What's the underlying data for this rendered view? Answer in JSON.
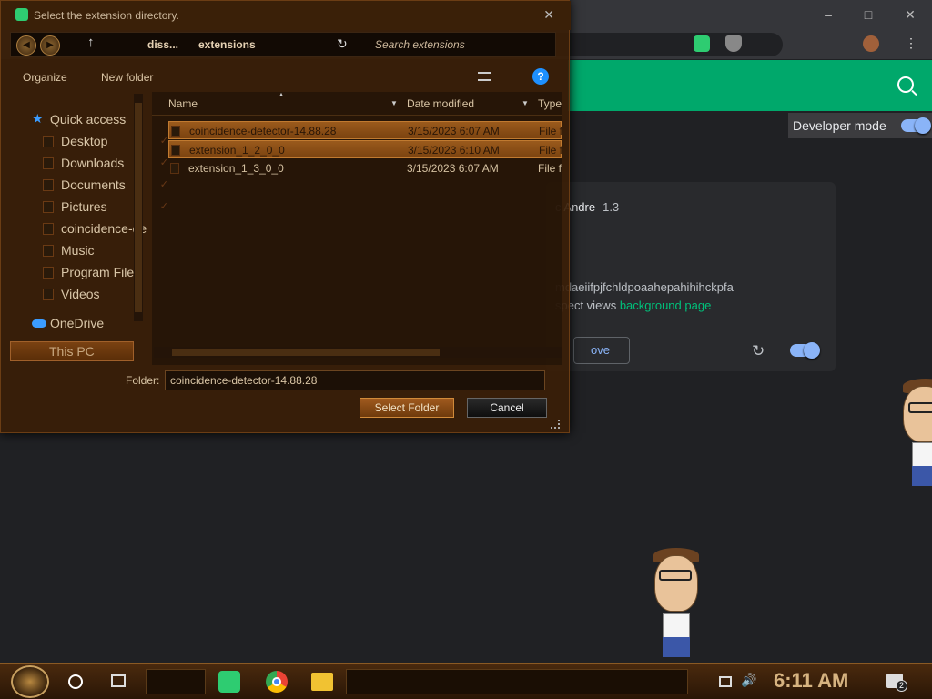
{
  "dialog": {
    "title": "Select the extension directory.",
    "breadcrumb": [
      "diss...",
      "extensions"
    ],
    "search_placeholder": "Search extensions",
    "organize_label": "Organize",
    "new_folder_label": "New folder",
    "tree": [
      {
        "label": "Quick access",
        "icon": "star-icon"
      },
      {
        "label": "Desktop",
        "icon": "folder-icon",
        "pinned": true
      },
      {
        "label": "Downloads",
        "icon": "folder-icon",
        "pinned": true
      },
      {
        "label": "Documents",
        "icon": "folder-icon",
        "pinned": true
      },
      {
        "label": "Pictures",
        "icon": "folder-icon",
        "pinned": true
      },
      {
        "label": "coincidence-de",
        "icon": "folder-icon"
      },
      {
        "label": "Music",
        "icon": "folder-icon"
      },
      {
        "label": "Program Files",
        "icon": "folder-icon"
      },
      {
        "label": "Videos",
        "icon": "folder-icon"
      },
      {
        "label": "OneDrive",
        "icon": "cloud-icon"
      },
      {
        "label": "This PC",
        "icon": "computer-icon"
      }
    ],
    "columns": {
      "name": "Name",
      "date": "Date modified",
      "type": "Type"
    },
    "files": [
      {
        "name": "coincidence-detector-14.88.28",
        "date": "3/15/2023 6:07 AM",
        "type": "File fo",
        "selected": true
      },
      {
        "name": "extension_1_2_0_0",
        "date": "3/15/2023 6:10 AM",
        "type": "File fo",
        "selected": true
      },
      {
        "name": "extension_1_3_0_0",
        "date": "3/15/2023 6:07 AM",
        "type": "File fo",
        "selected": false
      }
    ],
    "folder_label": "Folder:",
    "folder_value": "coincidence-detector-14.88.28",
    "select_button": "Select Folder",
    "cancel_button": "Cancel"
  },
  "browser": {
    "developer_mode_label": "Developer mode",
    "card": {
      "author": "c Andre",
      "version": "1.3",
      "id_text": "mdaeiifpjfchldpoaahepahihihckpfa",
      "inspect_prefix": "spect views",
      "inspect_link": "background page",
      "remove_label": "ove"
    }
  },
  "taskbar": {
    "time": "6:11 AM",
    "notification_count": "2"
  },
  "colors": {
    "accent_green": "#00a86b",
    "toggle_blue": "#8ab4f8",
    "dialog_brown": "#3a2008"
  }
}
